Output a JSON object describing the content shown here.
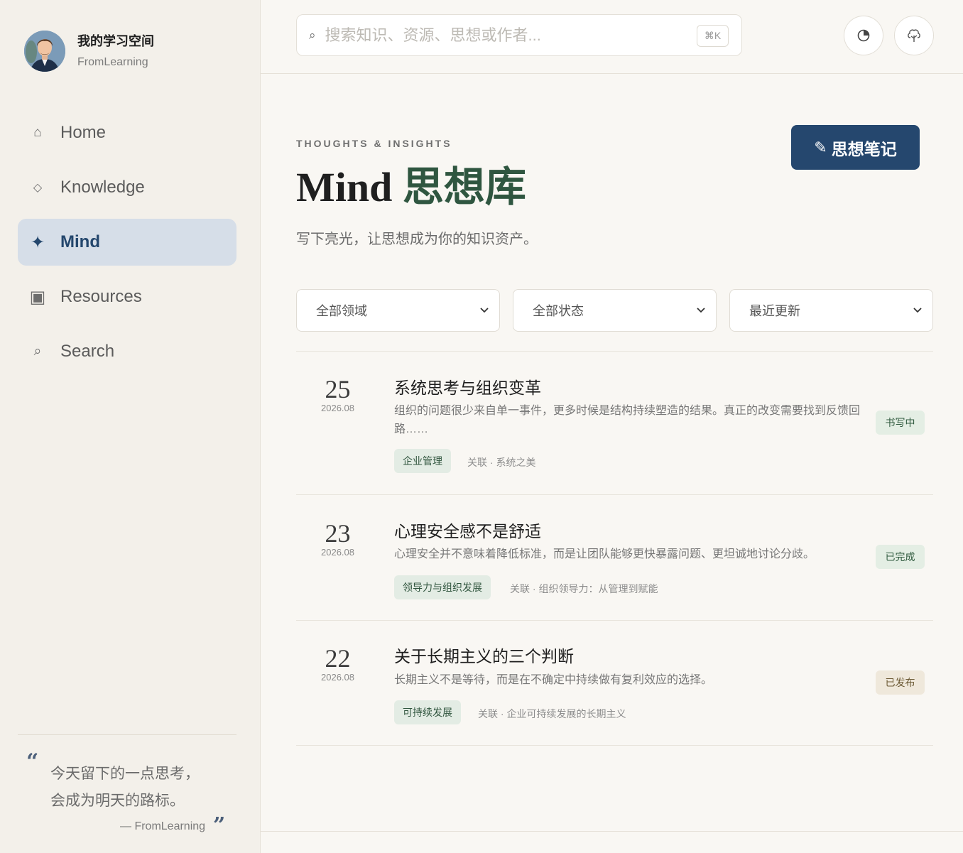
{
  "sidebar": {
    "profile": {
      "name": "我的学习空间",
      "subtitle": "FromLearning"
    },
    "nav": [
      {
        "label": "Home",
        "icon": "home-icon",
        "glyph": "⌂"
      },
      {
        "label": "Knowledge",
        "icon": "diamond-icon",
        "glyph": "◇"
      },
      {
        "label": "Mind",
        "icon": "sparkle-icon",
        "glyph": "✦"
      },
      {
        "label": "Resources",
        "icon": "box-icon",
        "glyph": "▣"
      },
      {
        "label": "Search",
        "icon": "search-icon",
        "glyph": "⌕"
      }
    ],
    "active": "Mind",
    "quote": {
      "line1": "今天留下的一点思考，",
      "line2": "会成为明天的路标。",
      "author": "— FromLearning",
      "open": "“",
      "close": "”"
    }
  },
  "header": {
    "search": {
      "placeholder": "搜索知识、资源、思想或作者...",
      "value": "",
      "shortcut": "⌘K"
    }
  },
  "main": {
    "eyebrow": "THOUGHTS & INSIGHTS",
    "title_en": "Mind",
    "title_zh": "思想库",
    "subtitle": "写下亮光，让思想成为你的知识资产。",
    "write_button": "思想笔记",
    "filters": [
      "全部领域",
      "全部状态",
      "最近更新"
    ],
    "entries": [
      {
        "day": "25",
        "ym": "2026.08",
        "title": "系统思考与组织变革",
        "desc": "组织的问题很少来自单一事件，更多时候是结构持续塑造的结果。真正的改变需要找到反馈回路……",
        "tag": "企业管理",
        "related": "关联 · 系统之美",
        "status": "书写中",
        "status_style": "green"
      },
      {
        "day": "23",
        "ym": "2026.08",
        "title": "心理安全感不是舒适",
        "desc": "心理安全并不意味着降低标准，而是让团队能够更快暴露问题、更坦诚地讨论分歧。",
        "tag": "领导力与组织发展",
        "related": "关联 · 组织领导力：从管理到赋能",
        "status": "已完成",
        "status_style": "green"
      },
      {
        "day": "22",
        "ym": "2026.08",
        "title": "关于长期主义的三个判断",
        "desc": "长期主义不是等待，而是在不确定中持续做有复利效应的选择。",
        "tag": "可持续发展",
        "related": "关联 · 企业可持续发展的长期主义",
        "status": "已发布",
        "status_style": "beige"
      }
    ]
  },
  "colors": {
    "accent": "#25476e",
    "green": "#2f5640",
    "sidebar_bg": "#f3f0ea",
    "page_bg": "#f9f7f3"
  }
}
